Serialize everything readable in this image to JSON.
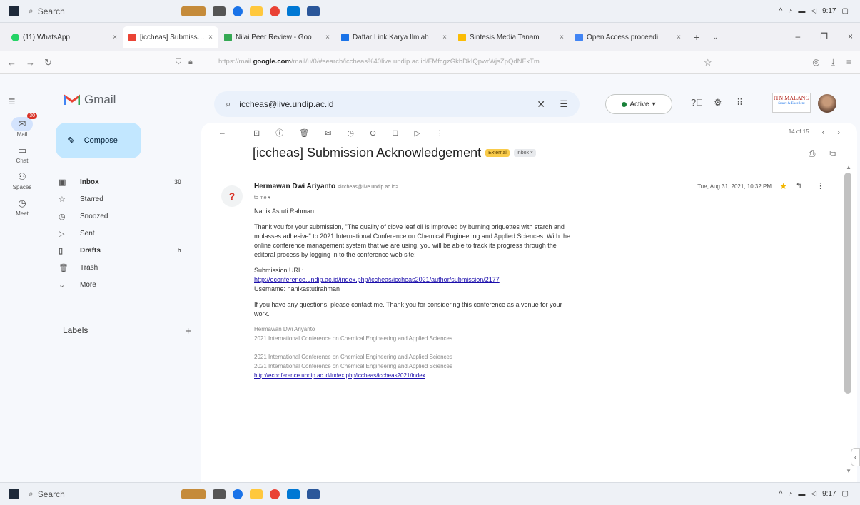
{
  "taskbar": {
    "search": "Search",
    "time": "9:17"
  },
  "tabs": [
    {
      "title": "(11) WhatsApp",
      "color": "#25d366"
    },
    {
      "title": "[iccheas] Submission A",
      "color": "#ea4335",
      "active": true
    },
    {
      "title": "Nilai Peer Review - Goo",
      "color": "#34a853"
    },
    {
      "title": "Daftar Link Karya Ilmiah",
      "color": "#1a73e8"
    },
    {
      "title": "Sintesis Media Tanam",
      "color": "#fbbc04"
    },
    {
      "title": "Open Access proceedi",
      "color": "#4285f4"
    }
  ],
  "address": {
    "url_prefix": "https://mail.",
    "url_host": "google.com",
    "url_rest": "/mail/u/0/#search/iccheas%40live.undip.ac.id/FMfcgzGkbDkIQpwrWjsZpQdNFkTm"
  },
  "gmail": {
    "brand": "Gmail",
    "search_value": "iccheas@live.undip.ac.id",
    "status": "Active",
    "compose": "Compose",
    "labels": "Labels",
    "institution": "ITN MALANG",
    "institution_sub": "Smart & Excellent"
  },
  "rail": [
    {
      "label": "Mail",
      "icon": "mail-icon",
      "badge": "30"
    },
    {
      "label": "Chat",
      "icon": "chat-icon"
    },
    {
      "label": "Spaces",
      "icon": "spaces-icon"
    },
    {
      "label": "Meet",
      "icon": "meet-icon"
    }
  ],
  "nav": [
    {
      "label": "Inbox",
      "icon": "inbox-icon",
      "count": "30",
      "bold": true
    },
    {
      "label": "Starred",
      "icon": "star-icon",
      "count": ""
    },
    {
      "label": "Snoozed",
      "icon": "clock-icon",
      "count": ""
    },
    {
      "label": "Sent",
      "icon": "send-icon",
      "count": ""
    },
    {
      "label": "Drafts",
      "icon": "draft-icon",
      "count": "h",
      "bold": true
    },
    {
      "label": "Trash",
      "icon": "trash-icon",
      "count": ""
    },
    {
      "label": "More",
      "icon": "chevron-down-icon",
      "count": ""
    }
  ],
  "email": {
    "pager": "14 of 15",
    "subject": "[iccheas] Submission Acknowledgement",
    "tag_external": "External",
    "tag_inbox": "Inbox ×",
    "sender_name": "Hermawan Dwi Ariyanto",
    "sender_email": "<iccheas@live.undip.ac.id>",
    "to": "to me ▾",
    "date": "Tue, Aug 31, 2021, 10:32 PM",
    "greeting": "Nanik Astuti Rahman:",
    "para1": "Thank you for your submission, \"The quality of clove leaf oil is improved by burning briquettes with starch and molasses adhesive\" to 2021 International Conference on Chemical Engineering and Applied Sciences. With the online conference management system that we are using, you will be able to track its progress through the editoral process by logging in to the conference web site:",
    "url_label": "Submission URL:",
    "submission_url": "http://econference.undip.ac.id/index.php/iccheas/iccheas2021/author/submission/2177",
    "username": "Username: nanikastutirahman",
    "para2": "If you have any questions, please contact me. Thank you for considering this conference as a venue for your work.",
    "sig1": "Hermawan Dwi Ariyanto",
    "sig2": "2021 International Conference on Chemical Engineering and Applied Sciences",
    "footer1": "2021 International Conference on Chemical Engineering and Applied Sciences",
    "footer2": "2021 International Conference on Chemical Engineering and Applied Sciences",
    "footer_url": "http://econference.undip.ac.id/index.php/iccheas/iccheas2021/index"
  }
}
